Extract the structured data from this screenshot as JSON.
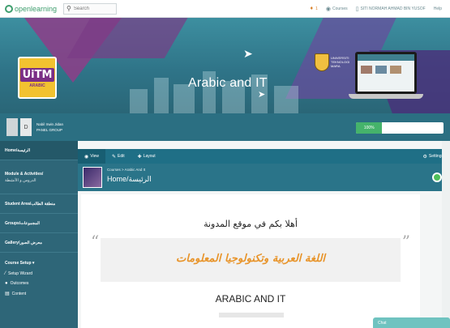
{
  "topbar": {
    "logo_text": "openlearning",
    "search_placeholder": "Search",
    "notif_count": "1",
    "courses_label": "Courses",
    "user_label": "SITI NORMAH AHMAD BIN YUSOF",
    "help_label": "Help"
  },
  "banner": {
    "title": "Arabic and IT",
    "logo_main": "UiTM",
    "logo_sub": "ARABIC",
    "crest_text": "UNIVERSITI TEKNOLOGI MARA"
  },
  "user": {
    "initial": "D",
    "name_line1": "Nabil Irwin Jidan",
    "name_line2": "PANEL GROUP",
    "progress_label": "100%",
    "progress_value": 0.3
  },
  "sidebar": {
    "items": [
      {
        "label": "Home/الرئيسة"
      },
      {
        "label": "Module & Activities/",
        "sub": "الدروس و الأنشطة"
      },
      {
        "label": "Student Area/منطقة الطالب"
      },
      {
        "label": "Groups/المجموعات"
      },
      {
        "label": "Gallery/معرض الصور"
      }
    ],
    "section_title": "Course Setup ▾",
    "sub_items": [
      {
        "label": "Setup Wizard"
      },
      {
        "label": "Outcomes"
      },
      {
        "label": "Content"
      }
    ]
  },
  "toolbar": {
    "view_label": "View",
    "edit_label": "Edit",
    "layout_label": "Layout",
    "settings_label": "Settings"
  },
  "page": {
    "breadcrumb": "Courses > Arabic And It",
    "title": "Home/الرئيسة"
  },
  "content": {
    "welcome": "أهلا بكم في موقع المدونة",
    "quote": "اللغة العربية وتكنولوجيا المعلومات",
    "heading": "ARABIC AND IT"
  },
  "chat": {
    "label": "Chat"
  },
  "colors": {
    "brand": "#3f9e6e",
    "primary": "#2a7489",
    "accent": "#e8942a"
  }
}
